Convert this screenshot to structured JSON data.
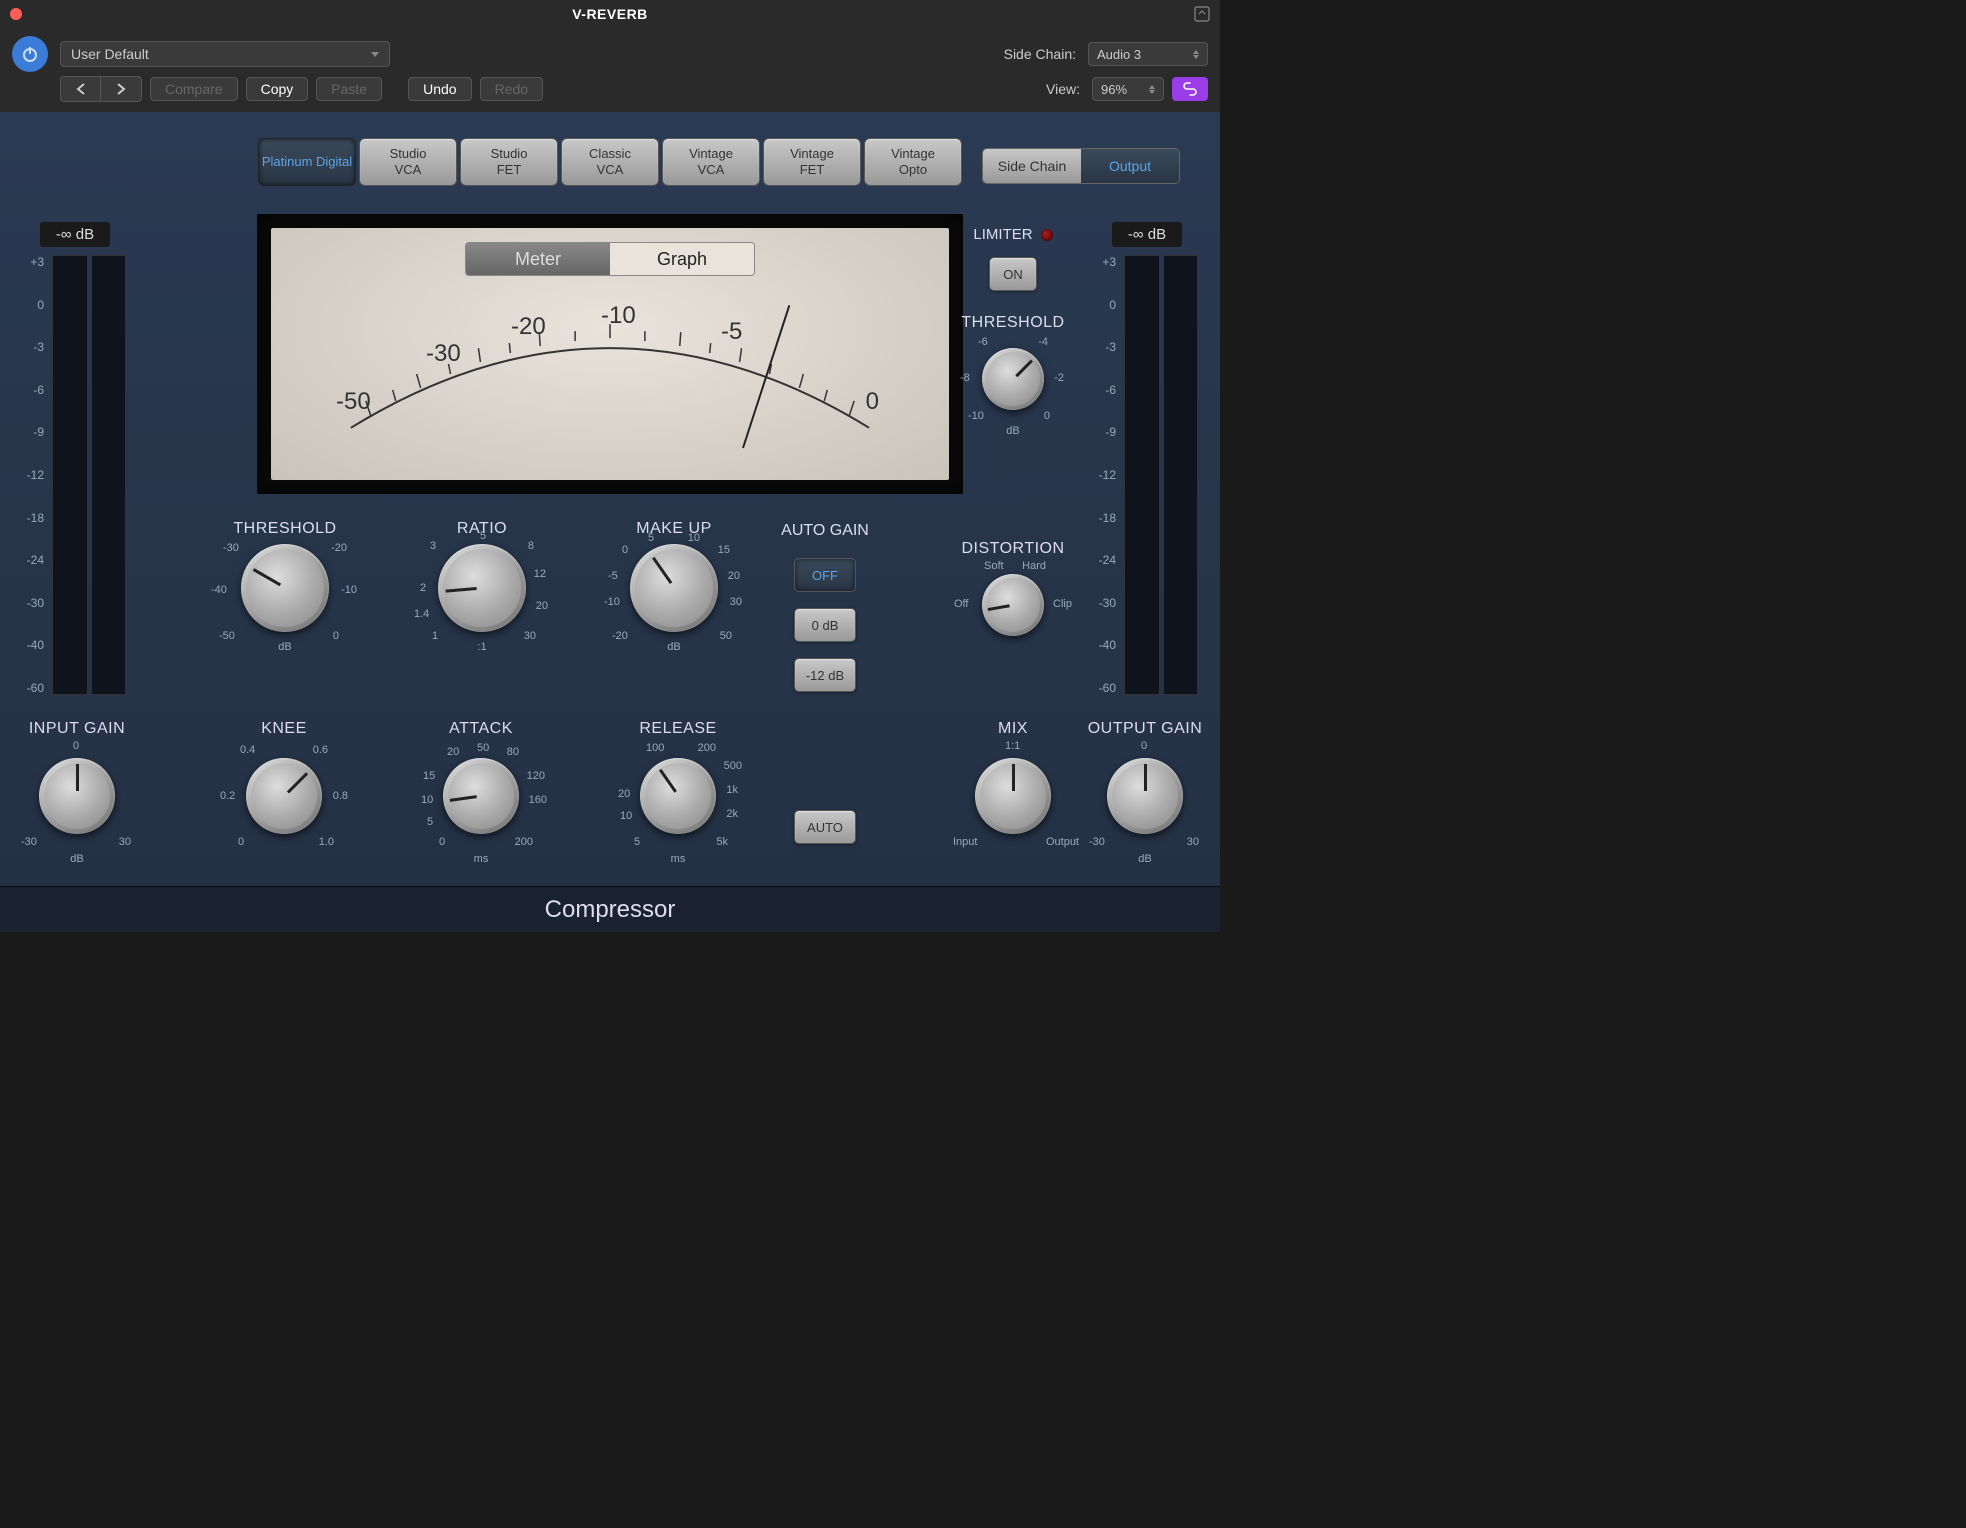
{
  "window": {
    "title": "V-REVERB"
  },
  "toolbar": {
    "preset": "User Default",
    "sidechain_label": "Side Chain:",
    "sidechain_value": "Audio 3",
    "compare": "Compare",
    "copy": "Copy",
    "paste": "Paste",
    "undo": "Undo",
    "redo": "Redo",
    "view_label": "View:",
    "zoom": "96%"
  },
  "models": [
    "Platinum Digital",
    "Studio VCA",
    "Studio FET",
    "Classic VCA",
    "Vintage VCA",
    "Vintage FET",
    "Vintage Opto"
  ],
  "models_active": 0,
  "sc_out": {
    "sidechain": "Side Chain",
    "output": "Output",
    "active": "output"
  },
  "meter_toggle": {
    "meter": "Meter",
    "graph": "Graph"
  },
  "vu_scale": [
    "-50",
    "-30",
    "-20",
    "-10",
    "-5",
    "0"
  ],
  "input_meter": {
    "value": "-∞ dB",
    "labels": [
      "+3",
      "0",
      "-3",
      "-6",
      "-9",
      "-12",
      "-18",
      "-24",
      "-30",
      "-40",
      "-60"
    ]
  },
  "output_meter": {
    "value": "-∞ dB",
    "labels": [
      "+3",
      "0",
      "-3",
      "-6",
      "-9",
      "-12",
      "-18",
      "-24",
      "-30",
      "-40",
      "-60"
    ]
  },
  "knobs": {
    "threshold": {
      "label": "THRESHOLD",
      "unit": "dB",
      "ticks": {
        "tl": "-30",
        "tr": "-20",
        "ml": "-40",
        "mr": "-10",
        "bl": "-50",
        "br": "0"
      }
    },
    "ratio": {
      "label": "RATIO",
      "unit": ":1",
      "ticks": {
        "t": "5",
        "tl": "3",
        "tr": "8",
        "ml": "2",
        "mr": "12",
        "bl_out": "1.4",
        "br_out": "20",
        "bl": "1",
        "br": "30"
      }
    },
    "makeup": {
      "label": "MAKE UP",
      "unit": "dB",
      "ticks": {
        "tl": "5",
        "tr": "10",
        "tl2": "0",
        "tr2": "15",
        "ml": "-5",
        "mr": "20",
        "ml2": "-10",
        "mr2": "30",
        "bl": "-20",
        "br": "50"
      }
    },
    "knee": {
      "label": "KNEE",
      "ticks": {
        "tl": "0.4",
        "tr": "0.6",
        "ml": "0.2",
        "mr": "0.8",
        "bl": "0",
        "br": "1.0"
      }
    },
    "attack": {
      "label": "ATTACK",
      "unit": "ms",
      "ticks": {
        "t": "50",
        "tl": "20",
        "tr": "80",
        "ml": "15",
        "mr": "120",
        "ml2": "10",
        "mr2": "160",
        "bl_out": "5",
        "br_out": "",
        "bl": "0",
        "br": "200"
      }
    },
    "release": {
      "label": "RELEASE",
      "unit": "ms",
      "ticks": {
        "tl": "100",
        "tr": "200",
        "mr": "500",
        "ml": "20",
        "mr2": "1k",
        "ml2": "10",
        "mr3": "2k",
        "bl": "5",
        "br": "5k"
      }
    },
    "input_gain": {
      "label": "INPUT GAIN",
      "unit": "dB",
      "ticks": {
        "t": "0",
        "bl": "-30",
        "br": "30"
      }
    },
    "output_gain": {
      "label": "OUTPUT GAIN",
      "unit": "dB",
      "ticks": {
        "t": "0",
        "bl": "-30",
        "br": "30"
      }
    },
    "limiter_threshold": {
      "label": "THRESHOLD",
      "unit": "dB",
      "ticks": {
        "tl": "-6",
        "tr": "-4",
        "ml": "-8",
        "mr": "-2",
        "bl": "-10",
        "br": "0"
      }
    },
    "distortion": {
      "label": "DISTORTION",
      "ticks": {
        "tl": "Soft",
        "tr": "Hard",
        "ml": "Off",
        "mr": "Clip"
      }
    },
    "mix": {
      "label": "MIX",
      "ticks": {
        "t": "1:1",
        "bl": "Input",
        "br": "Output"
      }
    }
  },
  "auto_gain": {
    "label": "AUTO GAIN",
    "off": "OFF",
    "zero": "0 dB",
    "neg12": "-12 dB",
    "auto": "AUTO",
    "active": "off"
  },
  "limiter": {
    "label": "LIMITER",
    "on": "ON"
  },
  "footer": "Compressor"
}
